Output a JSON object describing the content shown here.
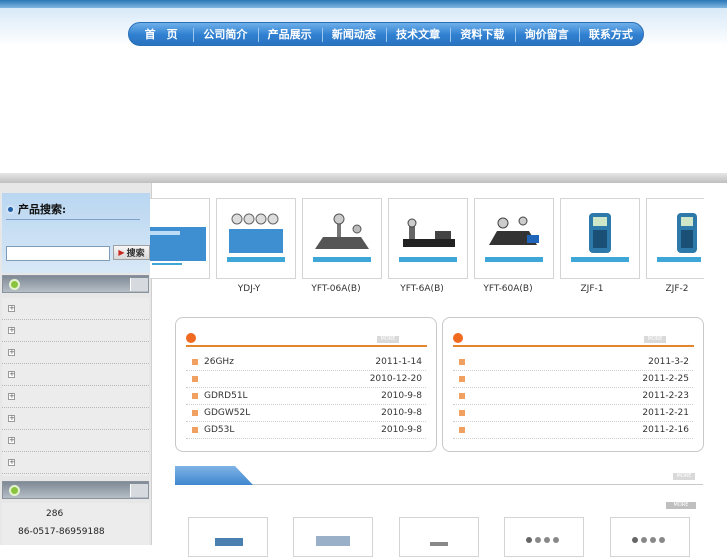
{
  "nav": {
    "items": [
      "首　页",
      "公司简介",
      "产品展示",
      "新闻动态",
      "技术文章",
      "资料下载",
      "询价留言",
      "联系方式"
    ]
  },
  "sidebar": {
    "search_title": "产品搜索:",
    "search_placeholder": "",
    "search_button": "搜索",
    "category_count": 8,
    "contact_lines": [
      "286",
      "86-0517-86959188"
    ]
  },
  "products": {
    "labels": [
      "",
      "YDJ-Y",
      "YFT-06A(B)",
      "YFT-6A(B)",
      "YFT-60A(B)",
      "ZJF-1",
      "ZJF-2"
    ]
  },
  "news_left": {
    "more_label": "MORE",
    "rows": [
      {
        "title": "26GHz",
        "date": "2011-1-14"
      },
      {
        "title": "",
        "date": "2010-12-20"
      },
      {
        "title": "GDRD51L",
        "date": "2010-9-8"
      },
      {
        "title": "GDGW52L",
        "date": "2010-9-8"
      },
      {
        "title": "GD53L",
        "date": "2010-9-8"
      }
    ]
  },
  "news_right": {
    "more_label": "MORE",
    "rows": [
      {
        "title": "",
        "date": "2011-3-2"
      },
      {
        "title": "",
        "date": "2011-2-25"
      },
      {
        "title": "",
        "date": "2011-2-23"
      },
      {
        "title": "",
        "date": "2011-2-21"
      },
      {
        "title": "",
        "date": "2011-2-16"
      }
    ]
  },
  "section": {
    "more_label": "MORE",
    "more2_label": "MORE"
  },
  "colors": {
    "nav_blue": "#2f7fd0",
    "accent_orange": "#e3842e",
    "green_dot": "#8ac43f"
  }
}
